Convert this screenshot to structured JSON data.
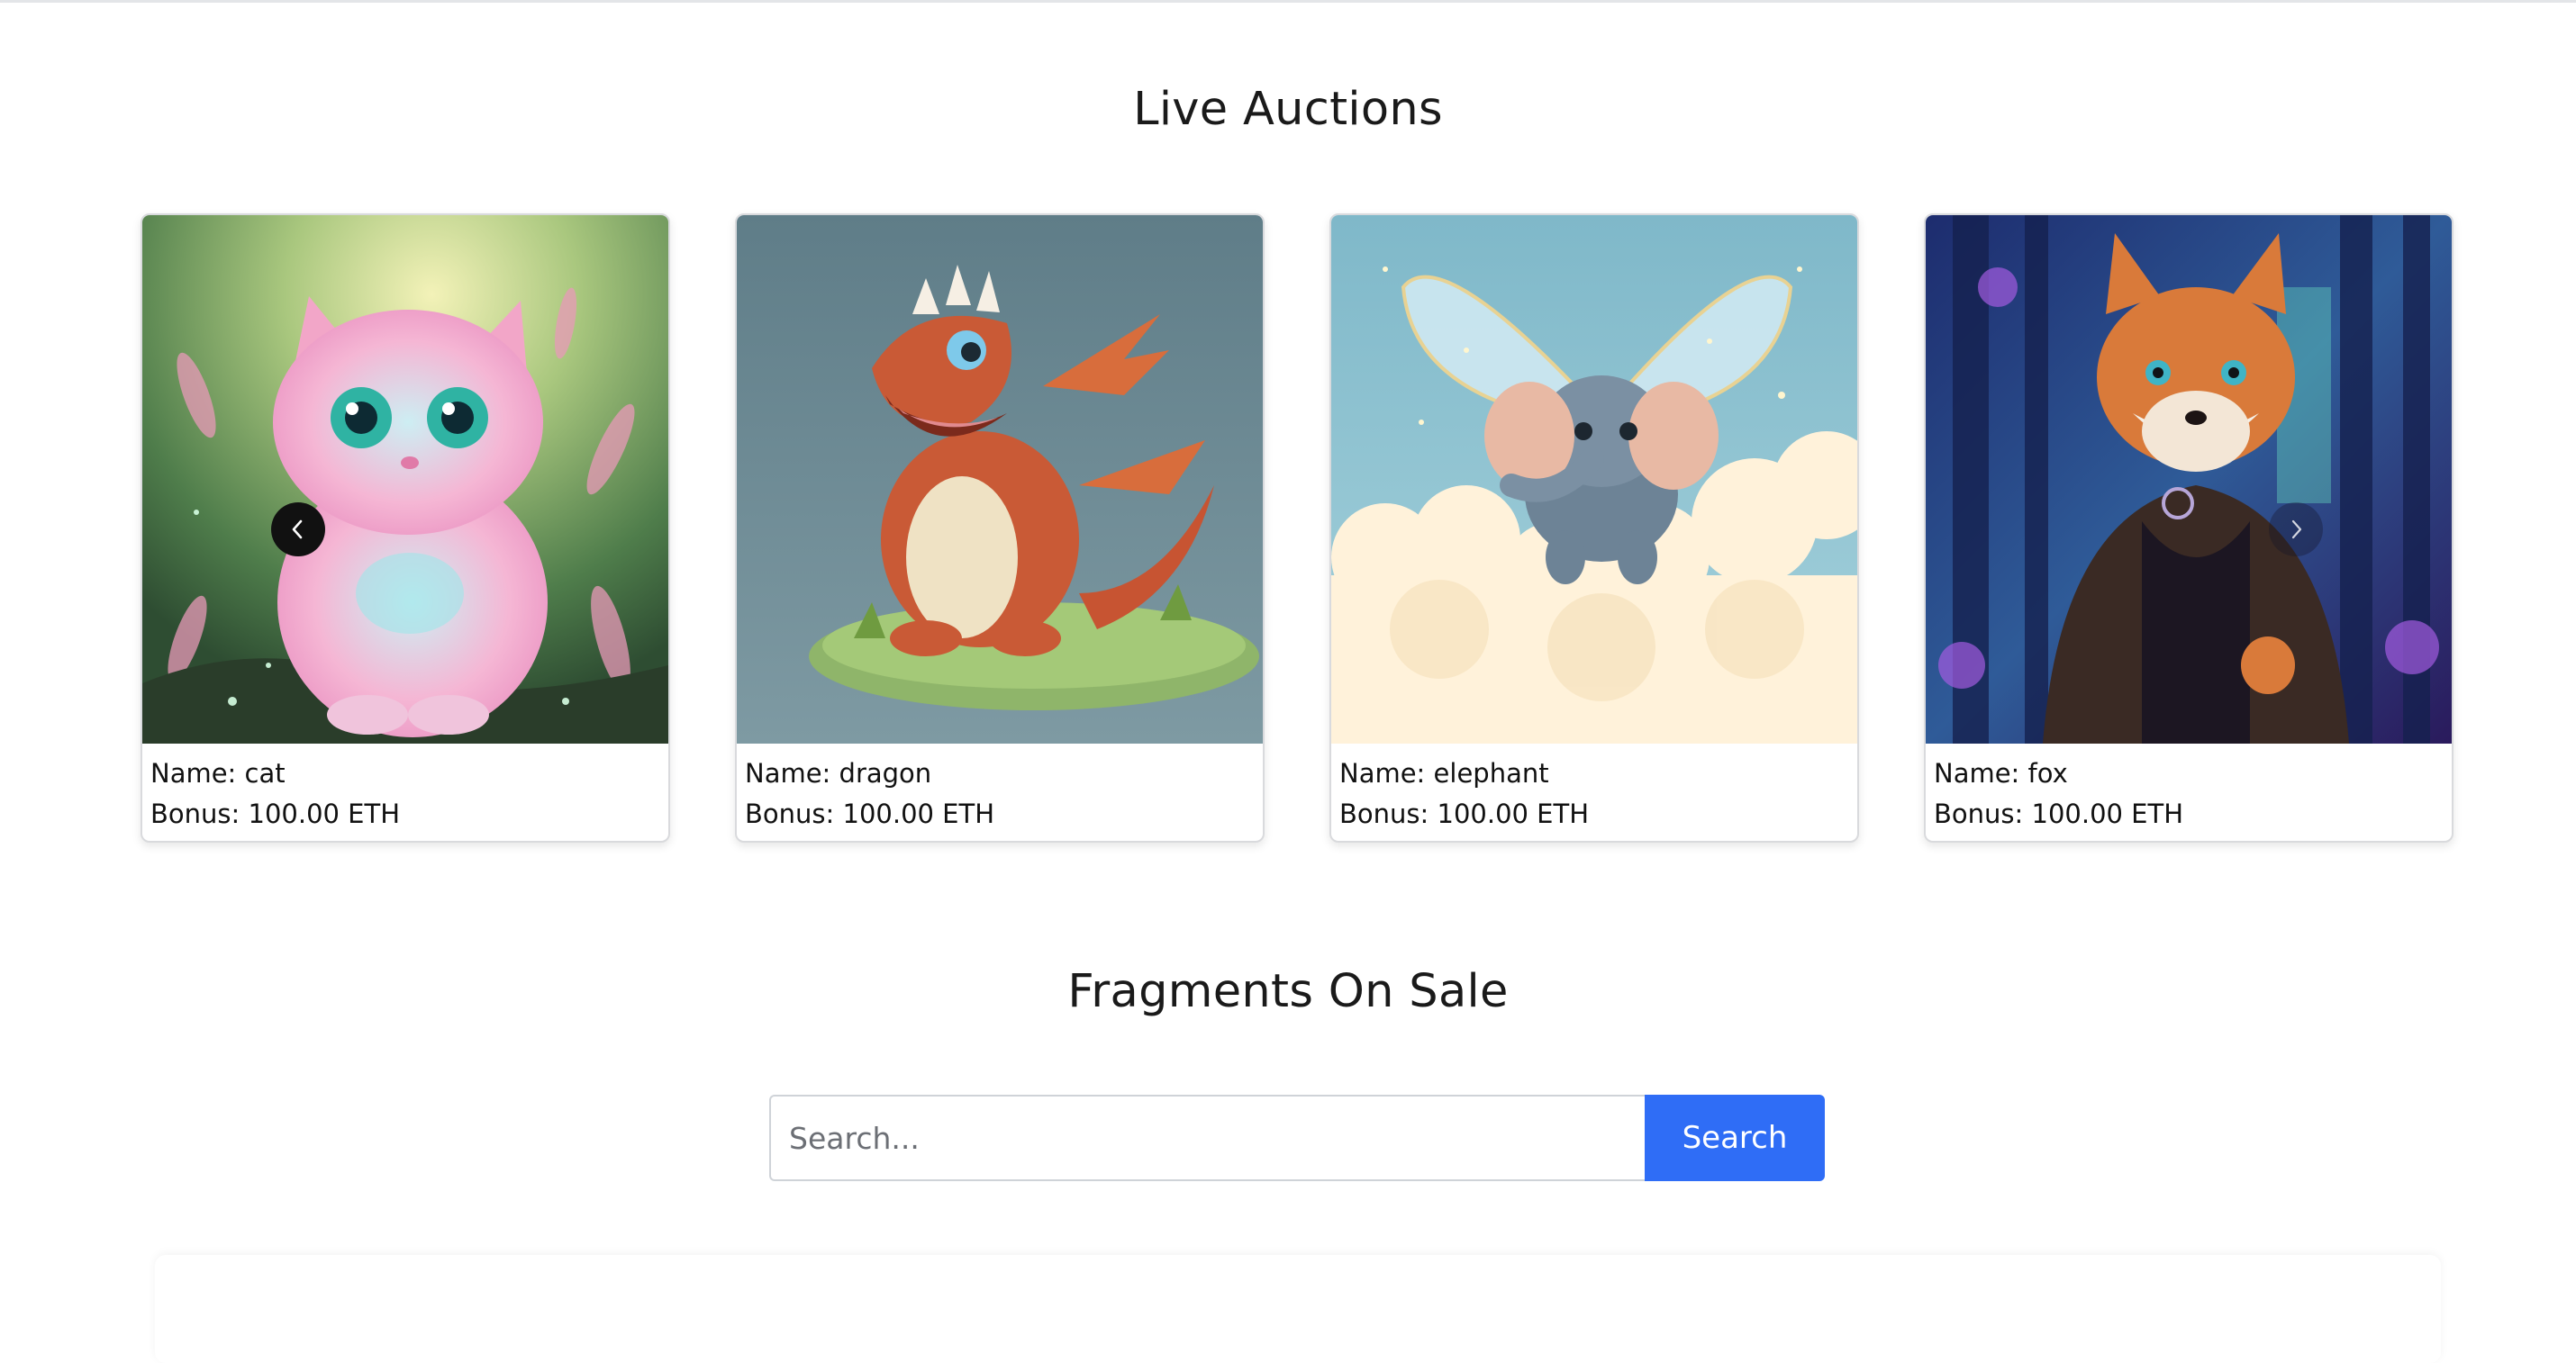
{
  "live_auctions": {
    "title": "Live Auctions",
    "items": [
      {
        "name_text": "Name: cat",
        "bonus_text": "Bonus: 100.00 ETH"
      },
      {
        "name_text": "Name: dragon",
        "bonus_text": "Bonus: 100.00 ETH"
      },
      {
        "name_text": "Name: elephant",
        "bonus_text": "Bonus: 100.00 ETH"
      },
      {
        "name_text": "Name: fox",
        "bonus_text": "Bonus: 100.00 ETH"
      }
    ],
    "prev_icon": "chevron-left-icon",
    "next_icon": "chevron-right-icon"
  },
  "fragments": {
    "title": "Fragments On Sale",
    "search_placeholder": "Search...",
    "search_button": "Search"
  },
  "colors": {
    "accent": "#2f6df6",
    "card_border": "#d9dadd"
  }
}
